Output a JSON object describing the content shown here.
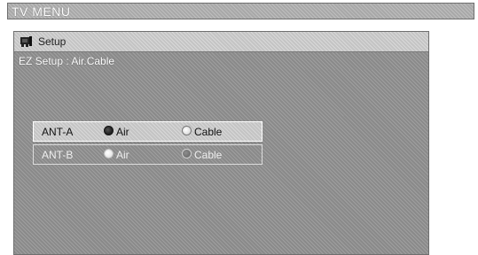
{
  "window": {
    "title": "TV MENU"
  },
  "menu": {
    "section_label": "Setup",
    "section_icon": "setup-icon",
    "breadcrumb": "EZ Setup : Air.Cable"
  },
  "antennas": [
    {
      "label": "ANT-A",
      "selected": "Air",
      "options": [
        "Air",
        "Cable"
      ],
      "active": true
    },
    {
      "label": "ANT-B",
      "selected": "Air",
      "options": [
        "Air",
        "Cable"
      ],
      "active": false
    }
  ],
  "colors": {
    "highlight_border": "#ffffff",
    "panel_dither": "#8a8a8a"
  }
}
